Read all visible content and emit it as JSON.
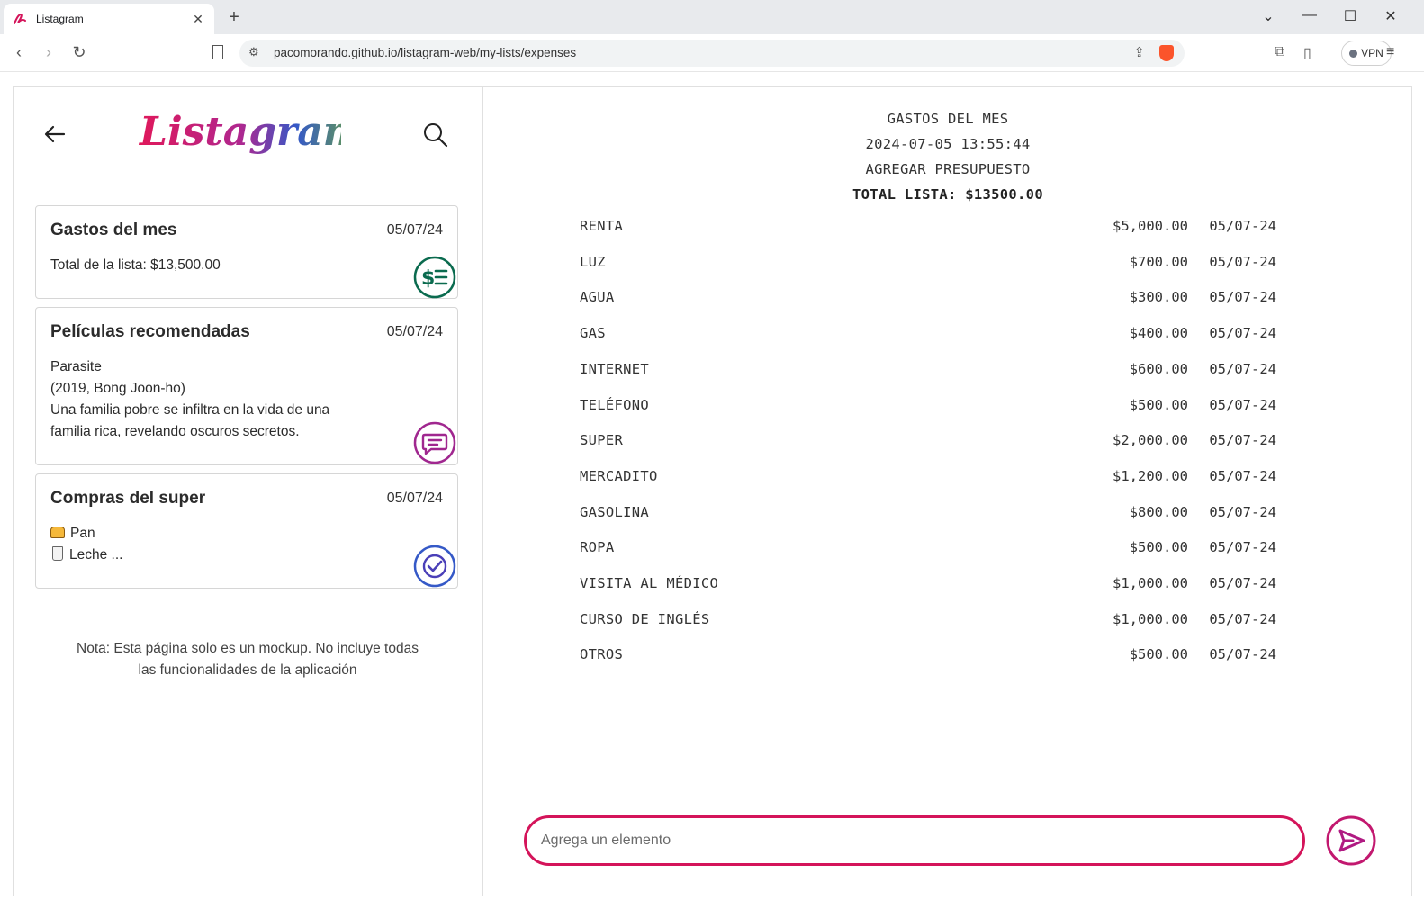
{
  "browser": {
    "tab_title": "Listagram",
    "url": "pacomorando.github.io/listagram-web/my-lists/expenses",
    "vpn_label": "VPN"
  },
  "app": {
    "logo_text": "Listagram",
    "colors": {
      "accent": "#d4145a",
      "green": "#0b6b4f",
      "purple": "#a0278f",
      "blue": "#3559c7"
    }
  },
  "lists": [
    {
      "title": "Gastos del mes",
      "date": "05/07/24",
      "lines": [
        "Total de la lista: $13,500.00"
      ],
      "icon": "dollar-list-icon"
    },
    {
      "title": "Películas recomendadas",
      "date": "05/07/24",
      "lines": [
        "Parasite",
        "(2019, Bong Joon-ho)",
        "Una familia pobre se infiltra en la vida de una",
        "familia rica, revelando oscuros secretos."
      ],
      "icon": "chat-icon"
    },
    {
      "title": "Compras del super",
      "date": "05/07/24",
      "lines": [
        "Pan",
        "Leche ..."
      ],
      "icon": "check-circle-icon"
    }
  ],
  "note": [
    "Nota: Esta página solo es un mockup. No incluye todas",
    "las funcionalidades de la aplicación"
  ],
  "detail": {
    "title": "GASTOS DEL MES",
    "datetime": "2024-07-05 13:55:44",
    "add_budget": "AGREGAR PRESUPUESTO",
    "total": "TOTAL LISTA: $13500.00",
    "items": [
      {
        "name": "RENTA",
        "amount": "$5,000.00",
        "date": "05/07-24"
      },
      {
        "name": "LUZ",
        "amount": "$700.00",
        "date": "05/07-24"
      },
      {
        "name": "AGUA",
        "amount": "$300.00",
        "date": "05/07-24"
      },
      {
        "name": "GAS",
        "amount": "$400.00",
        "date": "05/07-24"
      },
      {
        "name": "INTERNET",
        "amount": "$600.00",
        "date": "05/07-24"
      },
      {
        "name": "TELÉFONO",
        "amount": "$500.00",
        "date": "05/07-24"
      },
      {
        "name": "SUPER",
        "amount": "$2,000.00",
        "date": "05/07-24"
      },
      {
        "name": "MERCADITO",
        "amount": "$1,200.00",
        "date": "05/07-24"
      },
      {
        "name": "GASOLINA",
        "amount": "$800.00",
        "date": "05/07-24"
      },
      {
        "name": "ROPA",
        "amount": "$500.00",
        "date": "05/07-24"
      },
      {
        "name": "VISITA AL MÉDICO",
        "amount": "$1,000.00",
        "date": "05/07-24"
      },
      {
        "name": "CURSO DE INGLÉS",
        "amount": "$1,000.00",
        "date": "05/07-24"
      },
      {
        "name": "OTROS",
        "amount": "$500.00",
        "date": "05/07-24"
      }
    ],
    "input_placeholder": "Agrega un elemento"
  }
}
